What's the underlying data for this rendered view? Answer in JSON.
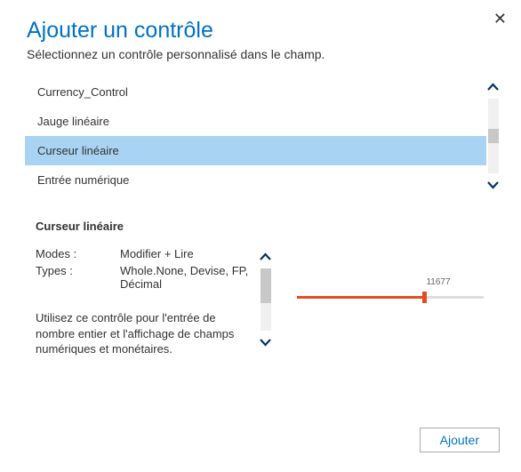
{
  "close_label": "✕",
  "title": "Ajouter un contrôle",
  "subtitle": "Sélectionnez un contrôle personnalisé dans le champ.",
  "list": {
    "items": [
      {
        "label": "Currency_Control",
        "selected": false
      },
      {
        "label": "Jauge linéaire",
        "selected": false
      },
      {
        "label": "Curseur linéaire",
        "selected": true
      },
      {
        "label": "Entrée numérique",
        "selected": false
      }
    ]
  },
  "detail": {
    "title": "Curseur linéaire",
    "modes_label": "Modes :",
    "modes_value": "Modifier + Lire",
    "types_label": "Types :",
    "types_value": "Whole.None, Devise, FP, Décimal",
    "description": "Utilisez ce contrôle pour l'entrée de nombre entier et l'affichage de champs numériques et monétaires."
  },
  "preview": {
    "value_text": "11677",
    "fill_percent": 68
  },
  "footer": {
    "add_label": "Ajouter"
  }
}
